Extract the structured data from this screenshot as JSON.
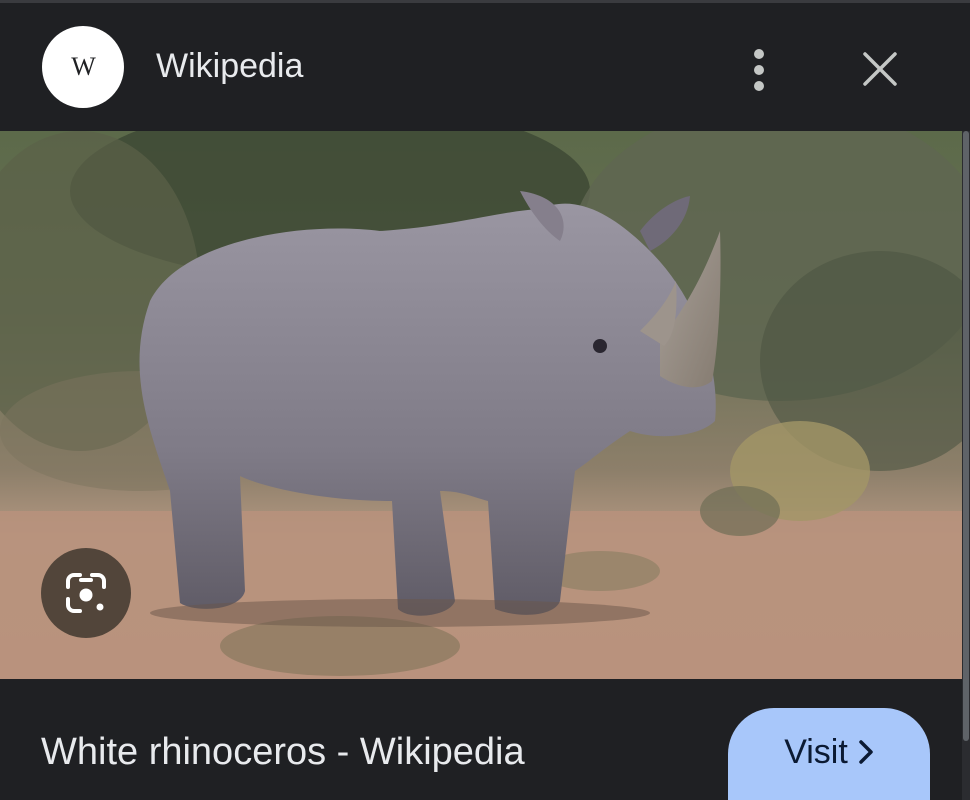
{
  "header": {
    "site_logo_letter": "W",
    "site_name": "Wikipedia",
    "more_icon": "more-vert-icon",
    "close_icon": "close-icon"
  },
  "image": {
    "subject": "White rhinoceros"
  },
  "lens": {
    "icon": "google-lens-icon"
  },
  "footer": {
    "title": "White rhinoceros - Wikipedia",
    "visit_label": "Visit",
    "visit_icon": "chevron-right-icon"
  },
  "colors": {
    "background": "#1f2023",
    "text": "#e8eaed",
    "visit_button": "#a8c7fa"
  }
}
